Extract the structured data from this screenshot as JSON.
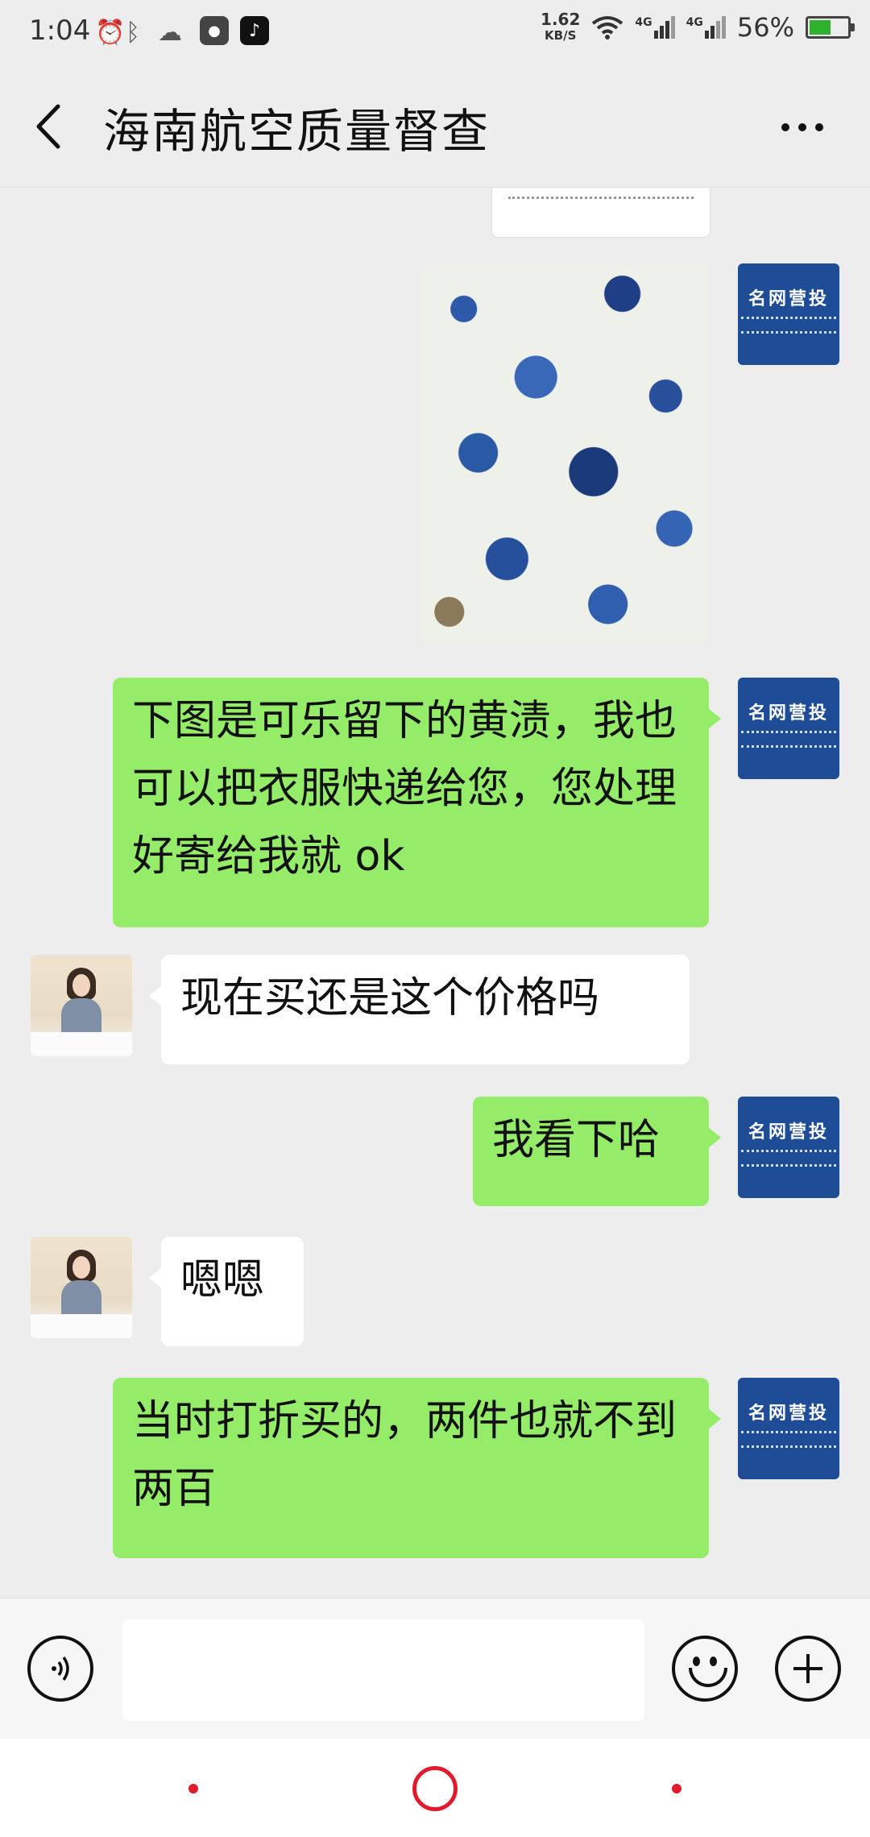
{
  "status_bar": {
    "time": "1:04",
    "net_speed_value": "1.62",
    "net_speed_unit": "KB/S",
    "signal1": "4G",
    "signal2": "4G",
    "battery_percent": "56%",
    "battery_level": 0.56
  },
  "header": {
    "title": "海南航空质量督查"
  },
  "right_avatar": {
    "logo_text": "名网营投"
  },
  "messages": [
    {
      "side": "right",
      "type": "text",
      "text": "下图是可乐留下的黄渍，我也可以把衣服快递给您，您处理好寄给我就 ok"
    },
    {
      "side": "left",
      "type": "text",
      "text": "现在买还是这个价格吗"
    },
    {
      "side": "right",
      "type": "text",
      "text": "我看下哈"
    },
    {
      "side": "left",
      "type": "text",
      "text": "嗯嗯"
    },
    {
      "side": "right",
      "type": "text",
      "text": "当时打折买的，两件也就不到两百"
    }
  ],
  "colors": {
    "sent_bubble": "#95ec69",
    "received_bubble": "#ffffff",
    "background": "#ededed",
    "nav_accent": "#e21b2c"
  }
}
